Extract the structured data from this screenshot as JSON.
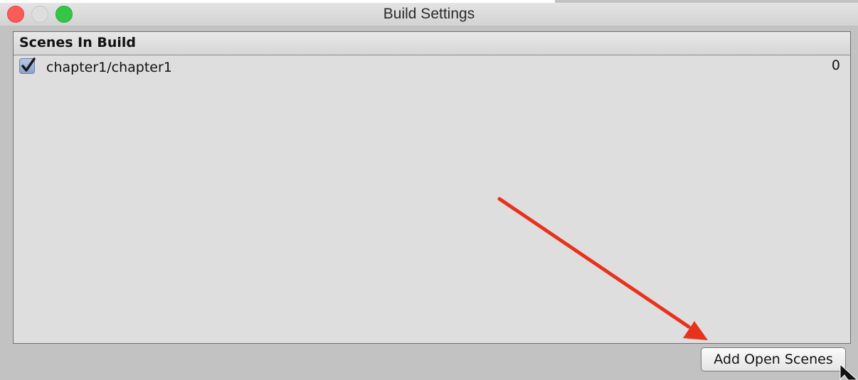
{
  "window": {
    "title": "Build Settings"
  },
  "scenes_panel": {
    "header": "Scenes In Build",
    "scenes": [
      {
        "name": "chapter1/chapter1",
        "index": "0",
        "checked": true
      }
    ]
  },
  "actions": {
    "add_open_scenes_label": "Add Open Scenes"
  },
  "annotation": {
    "arrow_color": "#e8321c"
  },
  "colors": {
    "window_bg": "#c2c2c2",
    "panel_bg": "#dedede",
    "close": "#fc5b57",
    "minimize": "#dedede",
    "maximize": "#33c748"
  }
}
